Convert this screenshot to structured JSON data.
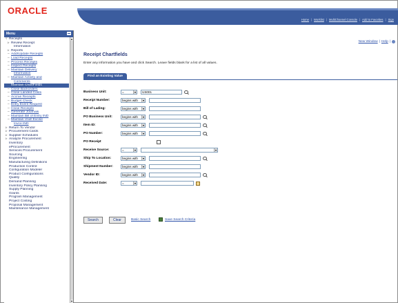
{
  "header": {
    "logo": "ORACLE",
    "links": [
      "Home",
      "Worklist",
      "MultiChannel Console",
      "Add to Favorites",
      "Sign"
    ]
  },
  "menu": {
    "title": "Menu",
    "items": [
      {
        "label": "Receipts",
        "level": 0,
        "twisty": "▿",
        "link": false,
        "selected": false
      },
      {
        "label": "Review Receipt",
        "level": 1,
        "twisty": "▹",
        "link": false,
        "selected": false
      },
      {
        "label": "Information",
        "level": 2,
        "twisty": "",
        "link": false,
        "selected": false
      },
      {
        "label": "Reports",
        "level": 1,
        "twisty": "▹",
        "link": false,
        "selected": false
      },
      {
        "label": "Add/Update Receipts",
        "level": 1,
        "twisty": "–",
        "link": true,
        "selected": false
      },
      {
        "label": "Load Receipts",
        "level": 1,
        "twisty": "–",
        "link": true,
        "selected": false
      },
      {
        "label": "Process Receipts",
        "level": 1,
        "twisty": "–",
        "link": true,
        "selected": false
      },
      {
        "label": "Inspect Receipts",
        "level": 1,
        "twisty": "–",
        "link": true,
        "selected": false
      },
      {
        "label": "Maintain Delivery",
        "level": 1,
        "twisty": "–",
        "link": true,
        "selected": false
      },
      {
        "label": "Information",
        "level": 2,
        "twisty": "",
        "link": true,
        "selected": false
      },
      {
        "label": "Maintain Activity and",
        "level": 1,
        "twisty": "–",
        "link": true,
        "selected": false
      },
      {
        "label": "Comments",
        "level": 2,
        "twisty": "",
        "link": true,
        "selected": false
      },
      {
        "label": "Maintain ChartFields",
        "level": 1,
        "twisty": "–",
        "link": true,
        "selected": true
      },
      {
        "label": "Close Backorders",
        "level": 1,
        "twisty": "–",
        "link": true,
        "selected": false
      },
      {
        "label": "Close Landed Costs",
        "level": 1,
        "twisty": "–",
        "link": true,
        "selected": false
      },
      {
        "label": "Accrue Receipts",
        "level": 1,
        "twisty": "–",
        "link": true,
        "selected": false
      },
      {
        "label": "Budget Check",
        "level": 1,
        "twisty": "–",
        "link": true,
        "selected": false
      },
      {
        "label": "Entry Event Request",
        "level": 1,
        "twisty": "–",
        "link": true,
        "selected": false
      },
      {
        "label": "Close Receipts",
        "level": 1,
        "twisty": "–",
        "link": true,
        "selected": false
      },
      {
        "label": "Generate Journals",
        "level": 1,
        "twisty": "–",
        "link": true,
        "selected": false
      },
      {
        "label": "Maintain Bill of Entry IND",
        "level": 1,
        "twisty": "–",
        "link": true,
        "selected": false
      },
      {
        "label": "Maintain Vndr Excise",
        "level": 1,
        "twisty": "–",
        "link": true,
        "selected": false
      },
      {
        "label": "Invce IND",
        "level": 2,
        "twisty": "",
        "link": true,
        "selected": false
      },
      {
        "label": "Return To Vendor",
        "level": 0,
        "twisty": "▹",
        "link": false,
        "selected": false
      },
      {
        "label": "Procurement Cards",
        "level": 0,
        "twisty": "▹",
        "link": false,
        "selected": false
      },
      {
        "label": "Supplier Schedules",
        "level": 0,
        "twisty": "▹",
        "link": false,
        "selected": false
      },
      {
        "label": "Analyze Procurement",
        "level": 0,
        "twisty": "▹",
        "link": false,
        "selected": false
      },
      {
        "label": "Inventory",
        "level": 0,
        "twisty": "",
        "link": false,
        "selected": false
      },
      {
        "label": "eProcurement",
        "level": 0,
        "twisty": "",
        "link": false,
        "selected": false
      },
      {
        "label": "Services Procurement",
        "level": 0,
        "twisty": "",
        "link": false,
        "selected": false
      },
      {
        "label": "Sourcing",
        "level": 0,
        "twisty": "",
        "link": false,
        "selected": false
      },
      {
        "label": "Engineering",
        "level": 0,
        "twisty": "",
        "link": false,
        "selected": false
      },
      {
        "label": "Manufacturing Definitions",
        "level": 0,
        "twisty": "",
        "link": false,
        "selected": false
      },
      {
        "label": "Production Control",
        "level": 0,
        "twisty": "",
        "link": false,
        "selected": false
      },
      {
        "label": "Configuration Modeler",
        "level": 0,
        "twisty": "",
        "link": false,
        "selected": false
      },
      {
        "label": "Product Configurations",
        "level": 0,
        "twisty": "",
        "link": false,
        "selected": false
      },
      {
        "label": "Quality",
        "level": 0,
        "twisty": "",
        "link": false,
        "selected": false
      },
      {
        "label": "Demand Planning",
        "level": 0,
        "twisty": "",
        "link": false,
        "selected": false
      },
      {
        "label": "Inventory Policy Planning",
        "level": 0,
        "twisty": "",
        "link": false,
        "selected": false
      },
      {
        "label": "Supply Planning",
        "level": 0,
        "twisty": "",
        "link": false,
        "selected": false
      },
      {
        "label": "Grants",
        "level": 0,
        "twisty": "",
        "link": false,
        "selected": false
      },
      {
        "label": "Program Management",
        "level": 0,
        "twisty": "",
        "link": false,
        "selected": false
      },
      {
        "label": "Project Costing",
        "level": 0,
        "twisty": "",
        "link": false,
        "selected": false
      },
      {
        "label": "Proposal Management",
        "level": 0,
        "twisty": "",
        "link": false,
        "selected": false
      },
      {
        "label": "Maintenance Management",
        "level": 0,
        "twisty": "",
        "link": false,
        "selected": false
      }
    ]
  },
  "top_links": {
    "new_window": "New Window",
    "help": "Help"
  },
  "page": {
    "title": "Receipt Chartfields",
    "instructions": "Enter any information you have and click Search. Leave fields blank for a list of all values.",
    "tab": "Find an Existing Value"
  },
  "form": {
    "business_unit": {
      "label": "Business Unit:",
      "op": "=",
      "value": "US001"
    },
    "receipt_number": {
      "label": "Receipt Number:",
      "op": "begins with",
      "value": ""
    },
    "bill_of_lading": {
      "label": "Bill of Lading:",
      "op": "begins with",
      "value": ""
    },
    "po_business_unit": {
      "label": "PO Business Unit:",
      "op": "begins with",
      "value": ""
    },
    "item_id": {
      "label": "Item ID:",
      "op": "begins with",
      "value": ""
    },
    "po_number": {
      "label": "PO Number:",
      "op": "begins with",
      "value": ""
    },
    "po_receipt": {
      "label": "PO Receipt"
    },
    "receive_source": {
      "label": "Receive Source:",
      "op": "=",
      "value": ""
    },
    "ship_to_location": {
      "label": "Ship To Location:",
      "op": "begins with",
      "value": ""
    },
    "shipment_number": {
      "label": "Shipment Number:",
      "op": "begins with",
      "value": ""
    },
    "vendor_id": {
      "label": "Vendor ID:",
      "op": "begins with",
      "value": ""
    },
    "received_date": {
      "label": "Received Date:",
      "op": "=",
      "value": ""
    }
  },
  "actions": {
    "search": "Search",
    "clear": "Clear",
    "basic_search": "Basic Search",
    "save_search": "Save Search Criteria"
  },
  "colors": {
    "brand_red": "#e2231a",
    "header_blue": "#3b5c9e",
    "link_blue": "#2a4fa8"
  }
}
